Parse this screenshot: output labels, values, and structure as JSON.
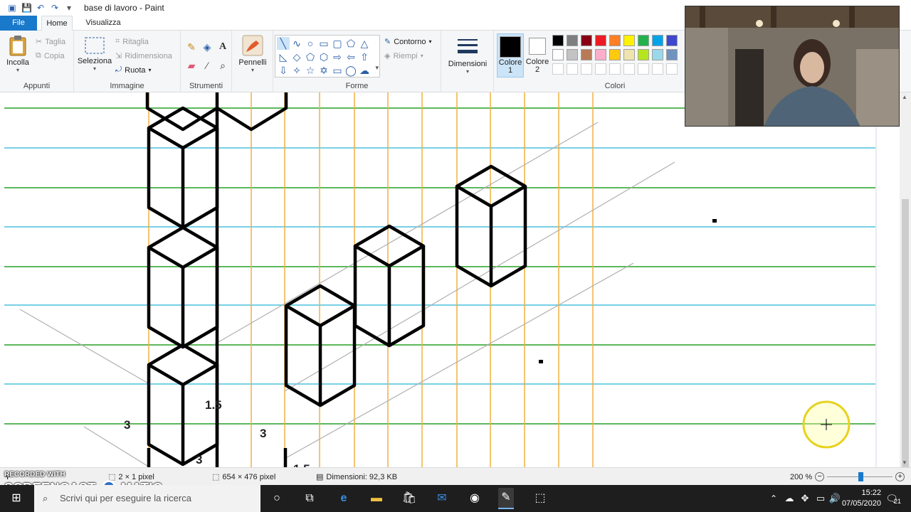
{
  "window": {
    "title": "base di lavoro - Paint"
  },
  "tabs": {
    "file": "File",
    "home": "Home",
    "view": "Visualizza"
  },
  "ribbon": {
    "clipboard": {
      "paste": "Incolla",
      "cut": "Taglia",
      "copy": "Copia",
      "label": "Appunti"
    },
    "image": {
      "select": "Seleziona",
      "crop": "Ritaglia",
      "resize": "Ridimensiona",
      "rotate": "Ruota",
      "label": "Immagine"
    },
    "tools": {
      "label": "Strumenti"
    },
    "brushes": {
      "label": "Pennelli"
    },
    "shapes": {
      "outline": "Contorno",
      "fill": "Riempi",
      "label": "Forme"
    },
    "size": {
      "label": "Dimensioni"
    },
    "colors": {
      "color1": "Colore",
      "color1_num": "1",
      "color2": "Colore",
      "color2_num": "2",
      "label": "Colori",
      "color1_value": "#000000",
      "color2_value": "#ffffff",
      "palette_row1": [
        "#000000",
        "#7f7f7f",
        "#880015",
        "#ed1c24",
        "#ff7f27",
        "#fff200",
        "#22b14c",
        "#00a2e8",
        "#3f48cc"
      ],
      "palette_row2": [
        "#ffffff",
        "#c3c3c3",
        "#b97a57",
        "#ffaec9",
        "#ffc90e",
        "#efe4b0",
        "#b5e61d",
        "#99d9ea",
        "#7092be"
      ],
      "palette_row3": [
        "#ffffff",
        "#ffffff",
        "#ffffff",
        "#ffffff",
        "#ffffff",
        "#ffffff",
        "#ffffff",
        "#ffffff",
        "#ffffff"
      ]
    }
  },
  "canvas": {
    "labels": [
      "1.5",
      "3",
      "3",
      "3",
      "1.5"
    ]
  },
  "status": {
    "selection": "2 × 1 pixel",
    "image_size": "654 × 476 pixel",
    "file_size": "Dimensioni: 92,3 KB",
    "zoom": "200 %"
  },
  "taskbar": {
    "search_placeholder": "Scrivi qui per eseguire la ricerca",
    "time": "15:22",
    "date": "07/05/2020",
    "notifications": "21"
  },
  "watermark": {
    "line1": "RECORDED WITH",
    "line2": "SCREENCAST",
    "line3": "MATIC"
  }
}
